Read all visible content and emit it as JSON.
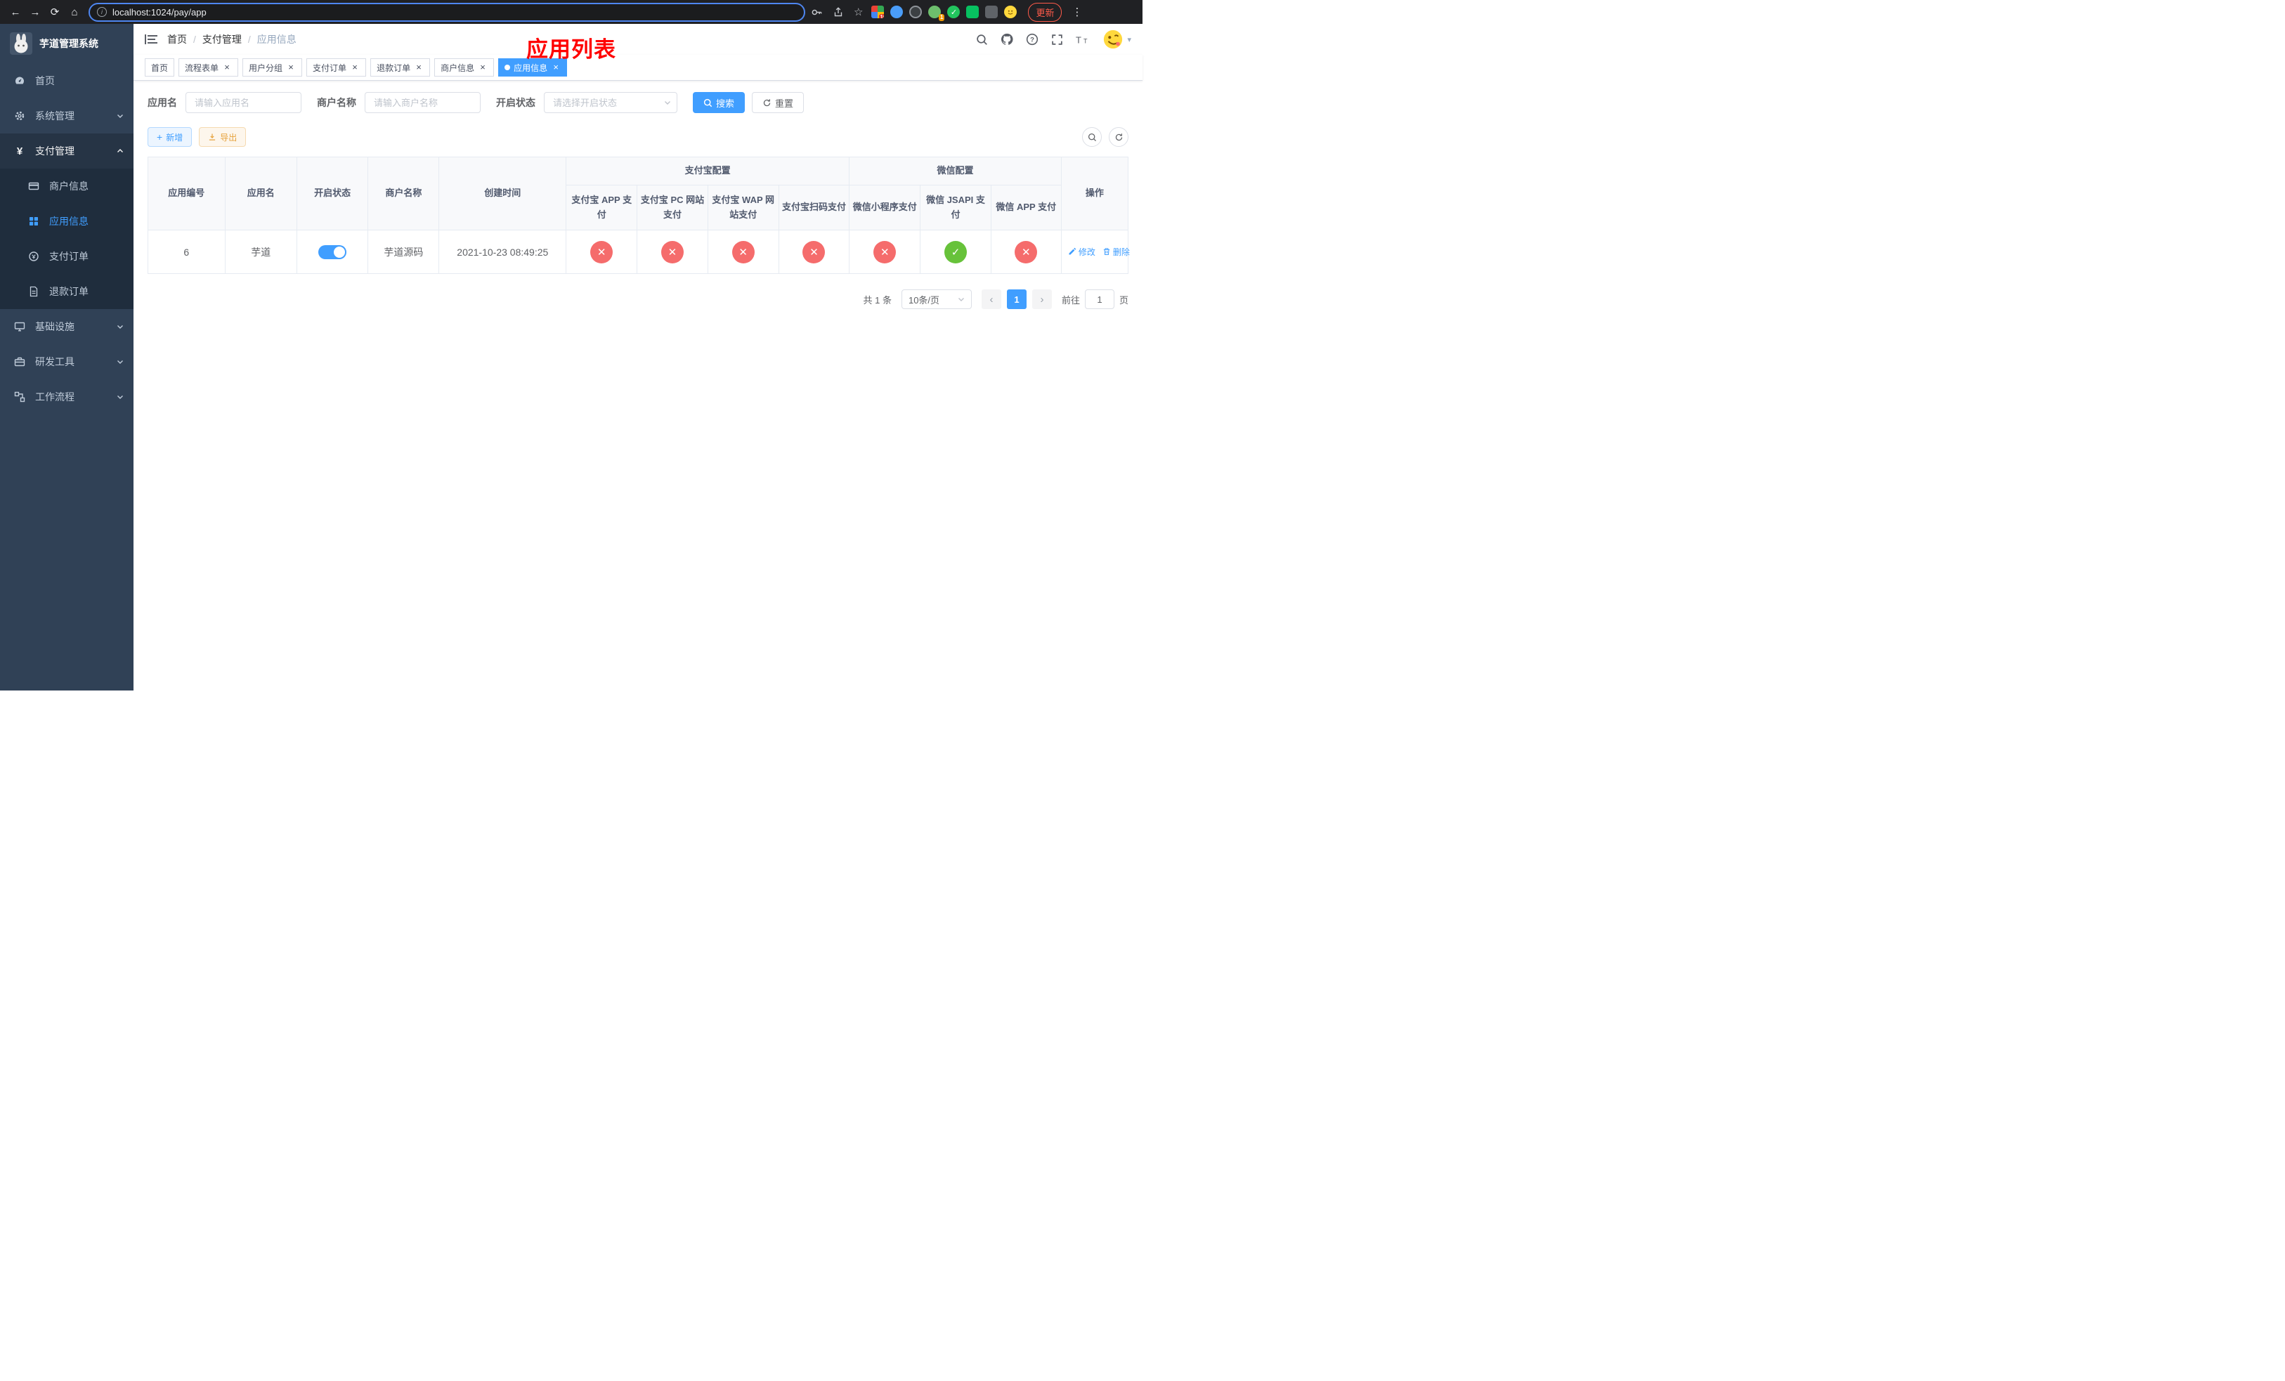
{
  "colors": {
    "primary": "#409eff",
    "success": "#67c23a",
    "danger": "#f56c6c",
    "warning": "#e6a23c",
    "overlay-red": "#ff0000"
  },
  "browser": {
    "url": "localhost:1024/pay/app",
    "update_label": "更新",
    "ext_badge_blocky": "10",
    "ext_badge_avatar": "1"
  },
  "sidebar": {
    "title": "芋道管理系统",
    "items": [
      {
        "label": "首页"
      },
      {
        "label": "系统管理"
      },
      {
        "label": "支付管理"
      },
      {
        "label": "基础设施"
      },
      {
        "label": "研发工具"
      },
      {
        "label": "工作流程"
      }
    ],
    "payment_children": [
      {
        "label": "商户信息"
      },
      {
        "label": "应用信息"
      },
      {
        "label": "支付订单"
      },
      {
        "label": "退款订单"
      }
    ]
  },
  "navbar": {
    "breadcrumb": [
      "首页",
      "支付管理",
      "应用信息"
    ]
  },
  "overlay_title": "应用列表",
  "tabs": [
    {
      "label": "首页"
    },
    {
      "label": "流程表单"
    },
    {
      "label": "用户分组"
    },
    {
      "label": "支付订单"
    },
    {
      "label": "退款订单"
    },
    {
      "label": "商户信息"
    },
    {
      "label": "应用信息"
    }
  ],
  "filter": {
    "app_name_label": "应用名",
    "app_name_placeholder": "请输入应用名",
    "merchant_label": "商户名称",
    "merchant_placeholder": "请输入商户名称",
    "status_label": "开启状态",
    "status_placeholder": "请选择开启状态",
    "search_label": "搜索",
    "reset_label": "重置"
  },
  "toolbar": {
    "add_label": "新增",
    "export_label": "导出"
  },
  "table": {
    "alipay_group": "支付宝配置",
    "wechat_group": "微信配置",
    "columns": [
      "应用编号",
      "应用名",
      "开启状态",
      "商户名称",
      "创建时间",
      "支付宝 APP 支付",
      "支付宝 PC 网站支付",
      "支付宝 WAP 网站支付",
      "支付宝扫码支付",
      "微信小程序支付",
      "微信 JSAPI 支付",
      "微信 APP 支付",
      "操作"
    ],
    "row": {
      "id": "6",
      "name": "芋道",
      "enabled": true,
      "merchant": "芋道源码",
      "created": "2021-10-23 08:49:25",
      "statuses": [
        "fail",
        "fail",
        "fail",
        "fail",
        "fail",
        "success",
        "fail"
      ],
      "edit_label": "修改",
      "delete_label": "删除"
    }
  },
  "pagination": {
    "total_text": "共 1 条",
    "page_size": "10条/页",
    "current_page": "1",
    "goto_label": "前往",
    "goto_value": "1",
    "page_unit": "页"
  }
}
